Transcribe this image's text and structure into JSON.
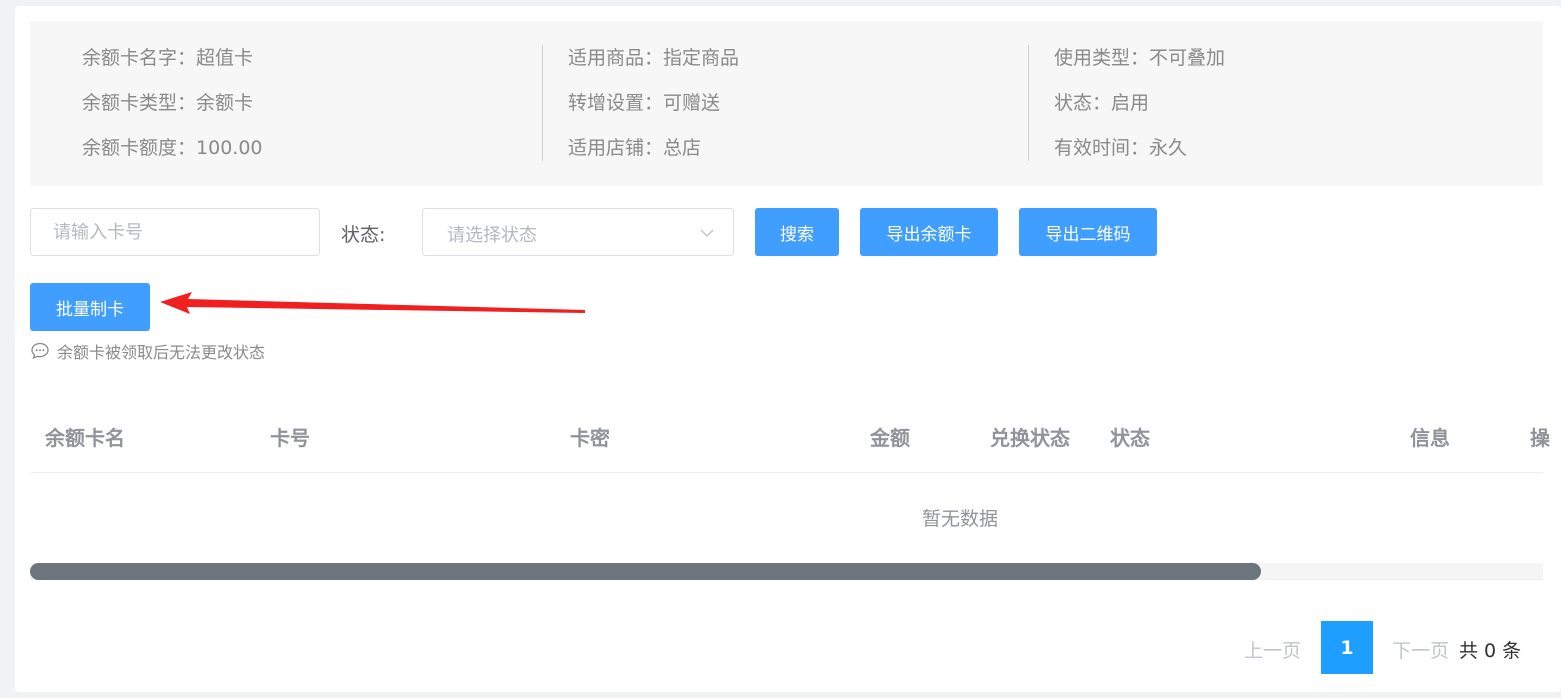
{
  "info": {
    "col1": [
      {
        "label": "余额卡名字",
        "value": "超值卡"
      },
      {
        "label": "余额卡类型",
        "value": "余额卡"
      },
      {
        "label": "余额卡额度",
        "value": "100.00"
      }
    ],
    "col2": [
      {
        "label": "适用商品",
        "value": "指定商品"
      },
      {
        "label": "转增设置",
        "value": "可赠送"
      },
      {
        "label": "适用店铺",
        "value": "总店"
      }
    ],
    "col3": [
      {
        "label": "使用类型",
        "value": "不可叠加"
      },
      {
        "label": "状态",
        "value": "启用"
      },
      {
        "label": "有效时间",
        "value": "永久"
      }
    ],
    "separator": "："
  },
  "filters": {
    "card_no_placeholder": "请输入卡号",
    "status_label": "状态:",
    "status_placeholder": "请选择状态",
    "search_label": "搜索",
    "export_card_label": "导出余额卡",
    "export_qr_label": "导出二维码"
  },
  "batch": {
    "button_label": "批量制卡",
    "annotation_arrow_color": "#f02020"
  },
  "tip": {
    "text": "余额卡被领取后无法更改状态",
    "icon": "message-dots-icon"
  },
  "table": {
    "columns": [
      "余额卡名",
      "卡号",
      "卡密",
      "金额",
      "兑换状态",
      "状态",
      "信息",
      "操"
    ],
    "empty_text": "暂无数据"
  },
  "pagination": {
    "prev": "上一页",
    "current": "1",
    "next": "下一页",
    "total": "共 0 条"
  },
  "colors": {
    "primary": "#409eff",
    "page_active": "#1e9fff",
    "scroll_thumb": "#6c757d"
  }
}
